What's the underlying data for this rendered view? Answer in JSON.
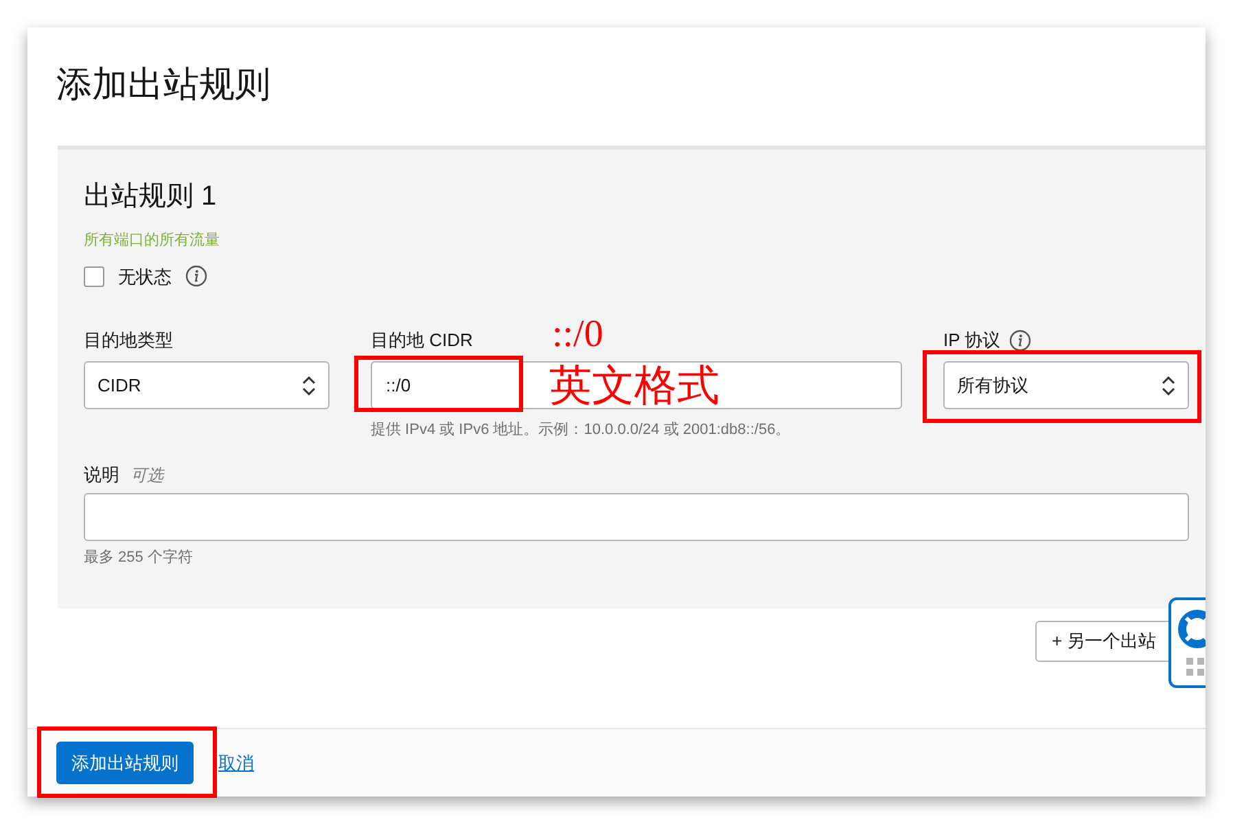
{
  "title": "添加出站规则",
  "rule": {
    "heading": "出站规则 1",
    "traffic_note": "所有端口的所有流量",
    "stateless": {
      "label": "无状态",
      "checked": false
    },
    "fields": [
      {
        "kind": "select",
        "label": "目的地类型",
        "value": "CIDR"
      },
      {
        "kind": "text",
        "label": "目的地 CIDR",
        "value": "::/0",
        "hint": "提供 IPv4 或 IPv6 地址。示例：10.0.0.0/24 或 2001:db8::/56。"
      },
      {
        "kind": "select",
        "label": "IP 协议",
        "info": true,
        "value": "所有协议"
      }
    ],
    "description": {
      "label": "说明",
      "optional": "可选",
      "hint": "最多 255 个字符"
    }
  },
  "add_another": "+ 另一个出站",
  "footer": {
    "primary": "添加出站规则",
    "cancel": "取消"
  },
  "annotations": [
    "::/0",
    "英文格式"
  ]
}
